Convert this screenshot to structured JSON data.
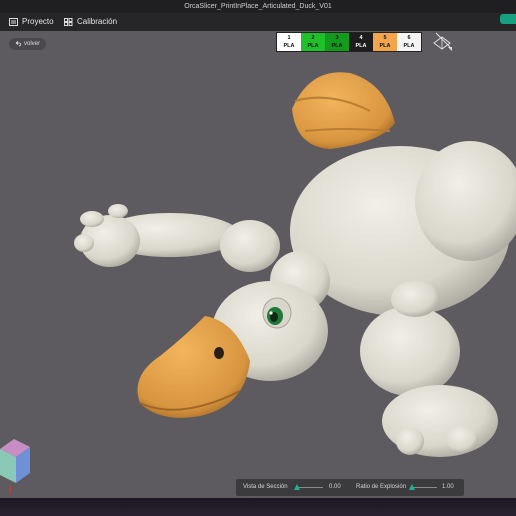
{
  "window": {
    "title": "OrcaSlicer_PrintInPlace_Articulated_Duck_V01"
  },
  "menubar": {
    "items": [
      {
        "label": "Proyecto",
        "icon": "project-icon"
      },
      {
        "label": "Calibración",
        "icon": "calibration-icon"
      }
    ]
  },
  "viewport": {
    "back_label": "volver",
    "filaments": [
      {
        "num": "1",
        "type": "PLA",
        "color": "#ffffff",
        "text": "#111111"
      },
      {
        "num": "2",
        "type": "PLA",
        "color": "#1fc12a",
        "text": "#111111"
      },
      {
        "num": "3",
        "type": "PLA",
        "color": "#149a1d",
        "text": "#111111"
      },
      {
        "num": "4",
        "type": "PLA",
        "color": "#1d1d1d",
        "text": "#ffffff"
      },
      {
        "num": "5",
        "type": "PLA",
        "color": "#f2a54a",
        "text": "#111111"
      },
      {
        "num": "6",
        "type": "PLA",
        "color": "#f4f4f4",
        "text": "#111111"
      }
    ]
  },
  "bottom_panel": {
    "section_label": "Vista de Sección",
    "section_value": "0.00",
    "explosion_label": "Ratio de Explosión",
    "explosion_value": "1.00"
  },
  "colors": {
    "accent": "#1db290",
    "model_body": "#e6e4d8",
    "model_beak": "#e5a24a"
  }
}
